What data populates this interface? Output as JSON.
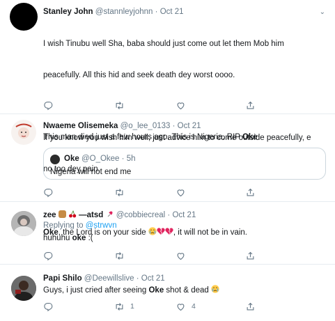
{
  "tweets": [
    {
      "name": "Stanley John",
      "handle": "@stannleyjohnn",
      "dot": "·",
      "time": "Oct 21",
      "line1": "I wish Tinubu well Sha, baba should just come out let them Mob him",
      "line2": "peacefully. All this hid and seek death dey worst oooo.",
      "line3": "If you know you wish him well, just advice him to come outside peacefully, e",
      "line4": "no too dey pain.",
      "line5_bold": "Oke",
      "line5_a": ", the Lord is on your side ",
      "line5_b": ", it will not be in vain."
    },
    {
      "name": "Nwaeme Olisemeka",
      "handle": "@o_lee_0133",
      "dot": "·",
      "time": "Oct 21",
      "text_a": "This man died just a few hours ago. This is Nigeria. RIP ",
      "text_bold": "Oke",
      "quote": {
        "name": "Oke",
        "handle": "@O_Okee",
        "dot": "·",
        "time": "5h",
        "text": "Nigeria will not end me"
      }
    },
    {
      "name": "zee",
      "name_suffix": "—atsd",
      "handle": "@cobbiecreal",
      "dot": "·",
      "time": "Oct 21",
      "replying_to": "Replying to ",
      "reply_handle": "@strwvn",
      "text_a": "huhuhu ",
      "text_bold": "oke",
      "text_b": " :("
    },
    {
      "name": "Papi Shilo",
      "handle": "@Deewillslive",
      "dot": "·",
      "time": "Oct 21",
      "text_a": "Guys, i just cried after seeing ",
      "text_bold": "Oke",
      "text_b": " shot & dead ",
      "retweets": "1",
      "likes": "4"
    }
  ],
  "icons": [
    "reply-icon",
    "retweet-icon",
    "like-icon",
    "share-icon",
    "chevron-down-icon",
    "crying-emoji-icon",
    "broken-heart-emoji-icon"
  ],
  "colors": {
    "link": "#1da1f2",
    "muted": "#657786",
    "border": "#e6ecf0",
    "broken_heart": "#e0245e",
    "emoji_face": "#ffcc4d"
  }
}
